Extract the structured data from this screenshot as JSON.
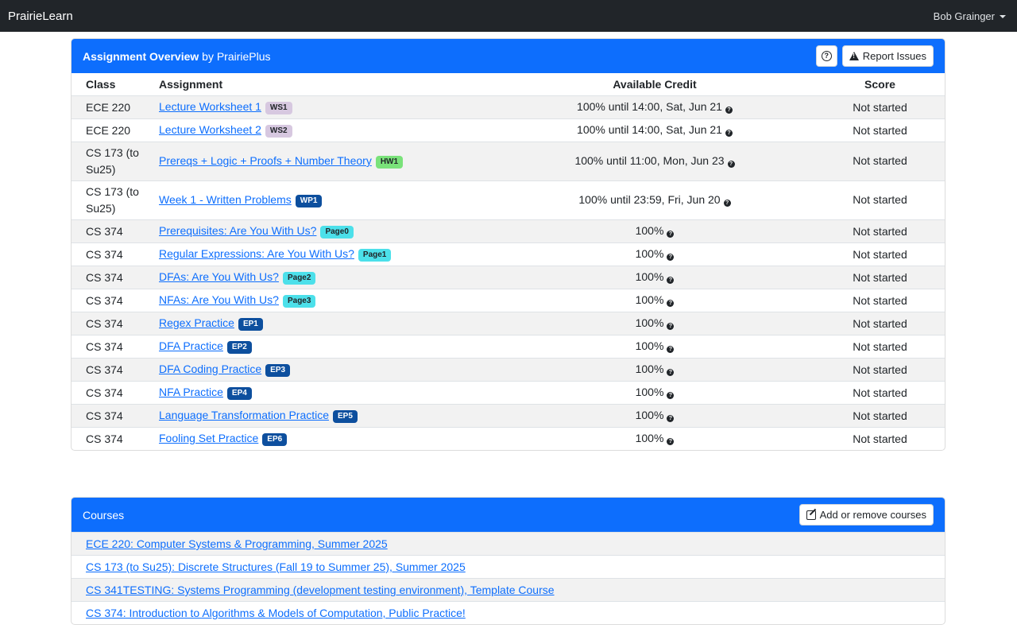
{
  "navbar": {
    "brand": "PrairieLearn",
    "user": "Bob Grainger"
  },
  "overview": {
    "title_bold": "Assignment Overview",
    "title_rest": " by PrairiePlus",
    "help_icon": "question-circle-icon",
    "report_label": "Report Issues",
    "report_icon": "warning-triangle-icon",
    "columns": [
      "Class",
      "Assignment",
      "Available Credit",
      "Score"
    ],
    "rows": [
      {
        "cls": "ECE 220",
        "assignment": "Lecture Worksheet 1",
        "badge": "WS1",
        "badge_bg": "#d7c8e0",
        "badge_fg": "#212529",
        "credit": "100% until 14:00, Sat, Jun 21",
        "score": "Not started",
        "tall": false
      },
      {
        "cls": "ECE 220",
        "assignment": "Lecture Worksheet 2",
        "badge": "WS2",
        "badge_bg": "#d7c8e0",
        "badge_fg": "#212529",
        "credit": "100% until 14:00, Sat, Jun 21",
        "score": "Not started",
        "tall": false
      },
      {
        "cls": "CS 173 (to Su25)",
        "assignment": "Prereqs + Logic + Proofs + Number Theory",
        "badge": "HW1",
        "badge_bg": "#7ae27a",
        "badge_fg": "#212529",
        "credit": "100% until 11:00, Mon, Jun 23",
        "score": "Not started",
        "tall": true
      },
      {
        "cls": "CS 173 (to Su25)",
        "assignment": "Week 1 - Written Problems",
        "badge": "WP1",
        "badge_bg": "#0d4f9e",
        "badge_fg": "#ffffff",
        "credit": "100% until 23:59, Fri, Jun 20",
        "score": "Not started",
        "tall": true
      },
      {
        "cls": "CS 374",
        "assignment": "Prerequisites: Are You With Us?",
        "badge": "Page0",
        "badge_bg": "#4ce0ea",
        "badge_fg": "#212529",
        "credit": "100%",
        "score": "Not started",
        "tall": false
      },
      {
        "cls": "CS 374",
        "assignment": "Regular Expressions: Are You With Us?",
        "badge": "Page1",
        "badge_bg": "#4ce0ea",
        "badge_fg": "#212529",
        "credit": "100%",
        "score": "Not started",
        "tall": false
      },
      {
        "cls": "CS 374",
        "assignment": "DFAs: Are You With Us?",
        "badge": "Page2",
        "badge_bg": "#4ce0ea",
        "badge_fg": "#212529",
        "credit": "100%",
        "score": "Not started",
        "tall": false
      },
      {
        "cls": "CS 374",
        "assignment": "NFAs: Are You With Us?",
        "badge": "Page3",
        "badge_bg": "#4ce0ea",
        "badge_fg": "#212529",
        "credit": "100%",
        "score": "Not started",
        "tall": false
      },
      {
        "cls": "CS 374",
        "assignment": "Regex Practice",
        "badge": "EP1",
        "badge_bg": "#0d4f9e",
        "badge_fg": "#ffffff",
        "credit": "100%",
        "score": "Not started",
        "tall": false
      },
      {
        "cls": "CS 374",
        "assignment": "DFA Practice",
        "badge": "EP2",
        "badge_bg": "#0d4f9e",
        "badge_fg": "#ffffff",
        "credit": "100%",
        "score": "Not started",
        "tall": false
      },
      {
        "cls": "CS 374",
        "assignment": "DFA Coding Practice",
        "badge": "EP3",
        "badge_bg": "#0d4f9e",
        "badge_fg": "#ffffff",
        "credit": "100%",
        "score": "Not started",
        "tall": false
      },
      {
        "cls": "CS 374",
        "assignment": "NFA Practice",
        "badge": "EP4",
        "badge_bg": "#0d4f9e",
        "badge_fg": "#ffffff",
        "credit": "100%",
        "score": "Not started",
        "tall": false
      },
      {
        "cls": "CS 374",
        "assignment": "Language Transformation Practice",
        "badge": "EP5",
        "badge_bg": "#0d4f9e",
        "badge_fg": "#ffffff",
        "credit": "100%",
        "score": "Not started",
        "tall": false
      },
      {
        "cls": "CS 374",
        "assignment": "Fooling Set Practice",
        "badge": "EP6",
        "badge_bg": "#0d4f9e",
        "badge_fg": "#ffffff",
        "credit": "100%",
        "score": "Not started",
        "tall": false
      }
    ]
  },
  "courses": {
    "title": "Courses",
    "add_label": "Add or remove courses",
    "add_icon": "edit-icon",
    "items": [
      "ECE 220: Computer Systems & Programming, Summer 2025",
      "CS 173 (to Su25): Discrete Structures (Fall 19 to Summer 25), Summer 2025",
      "CS 341TESTING: Systems Programming (development testing environment), Template Course",
      "CS 374: Introduction to Algorithms & Models of Computation, Public Practice!"
    ]
  },
  "colors": {
    "primary": "#0d6efd",
    "navbar": "#212529",
    "stripe": "#f2f2f2"
  }
}
